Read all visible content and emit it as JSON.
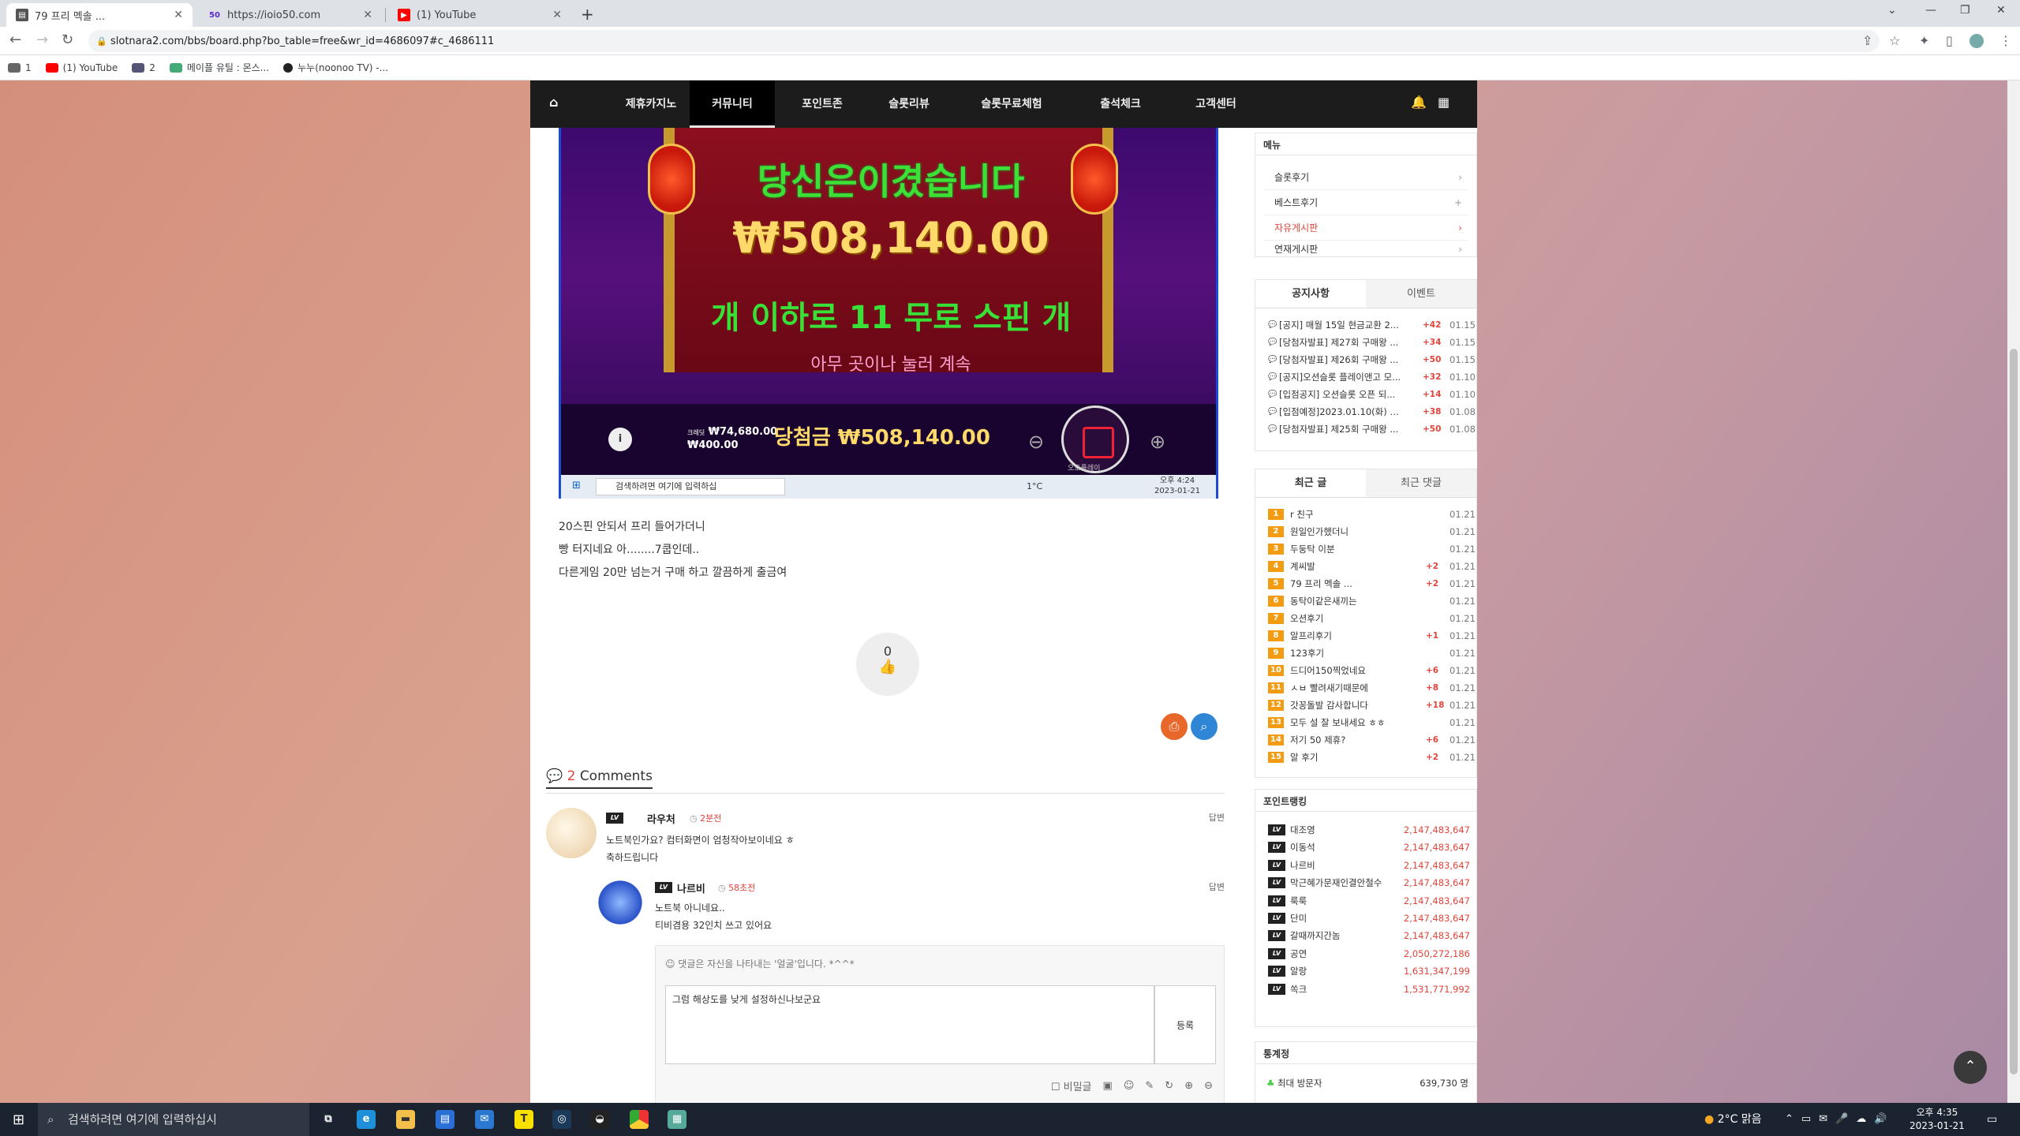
{
  "browser": {
    "tabs": [
      {
        "title": "79 프리 멕솔 ...",
        "active": true
      },
      {
        "title": "https://ioio50.com",
        "active": false
      },
      {
        "title": "(1) YouTube",
        "active": false
      }
    ],
    "url": "slotnara2.com/bbs/board.php?bo_table=free&wr_id=4686097#c_4686111",
    "bookmarks": [
      "1",
      "(1) YouTube",
      "2",
      "메이플 유틸 : 몬스...",
      "누누(noonoo TV) -..."
    ]
  },
  "site": {
    "nav": [
      "제휴카지노",
      "커뮤니티",
      "포인트존",
      "슬롯리뷰",
      "슬롯무료체험",
      "출석체크",
      "고객센터"
    ],
    "active_nav": "커뮤니티"
  },
  "screenshot": {
    "won_title": "당신은이겼습니다",
    "amount": "₩508,140.00",
    "freespin": "개 이하로 11 무로 스핀 개",
    "continue_text": "아무 곳이나 눌러 계속",
    "balance_label": "크레딧",
    "balance": "₩74,680.00",
    "bet": "₩400.00",
    "total_label": "당첨금 ₩508,140.00",
    "autoplay": "오토플레이",
    "taskbar_search": "검색하려면 여기에 입력하십",
    "temp": "1°C",
    "time": "오후 4:24",
    "date": "2023-01-21"
  },
  "post": {
    "lines": [
      "20스핀 안되서 프리 들어가더니",
      "빵 터지네요 아........7쿱인데..",
      "다른게임 20만 넘는거 구매 하고 깔끔하게 출금여"
    ],
    "likes": "0"
  },
  "comments": {
    "count": "2",
    "label": "Comments",
    "items": [
      {
        "name": "라우처",
        "time": "2분전",
        "reply": "답변",
        "text": [
          "노트북인가요? 컴터화면이 엄청작아보이네요 ㅎ",
          "축하드립니다"
        ]
      },
      {
        "name": "나르비",
        "time": "58초전",
        "reply": "답변",
        "text": [
          "노트북 아니네요..",
          "티비겸용 32인치 쓰고 있어요"
        ]
      }
    ],
    "form_hint": "댓글은 자신을 나타내는 '얼굴'입니다. *^^*",
    "form_text": "그럼 해상도를 낮게 설정하신나보군요",
    "submit": "등록",
    "secret": "비밀글"
  },
  "sidebar": {
    "menu_title": "메뉴",
    "menu": [
      "슬롯후기",
      "베스트후기",
      "자유게시판",
      "연재게시판"
    ],
    "notice_tabs": [
      "공지사항",
      "이벤트"
    ],
    "notices": [
      {
        "t": "[공지] 매월 15일 현금교환 2...",
        "c": "+42",
        "d": "01.15"
      },
      {
        "t": "[당첨자발표] 제27회 구매왕 ...",
        "c": "+34",
        "d": "01.15"
      },
      {
        "t": "[당첨자발표] 제26회 구매왕 ...",
        "c": "+50",
        "d": "01.15"
      },
      {
        "t": "[공지]오션슬롯 플레이앤고 모...",
        "c": "+32",
        "d": "01.10"
      },
      {
        "t": "[입점공지] 오션슬롯 오픈 되...",
        "c": "+14",
        "d": "01.10"
      },
      {
        "t": "[입점예정]2023.01.10(화) 낮 1...",
        "c": "+38",
        "d": "01.08"
      },
      {
        "t": "[당첨자발표] 제25회 구매왕 ...",
        "c": "+50",
        "d": "01.08"
      }
    ],
    "recent_tabs": [
      "최근 글",
      "최근 댓글"
    ],
    "recent": [
      {
        "t": "r 친구",
        "c": "",
        "d": "01.21"
      },
      {
        "t": "원일인가했더니",
        "c": "",
        "d": "01.21"
      },
      {
        "t": "두둥탁 이분",
        "c": "",
        "d": "01.21"
      },
      {
        "t": "계씨발",
        "c": "+2",
        "d": "01.21"
      },
      {
        "t": "79 프리 멕솔 ...",
        "c": "+2",
        "d": "01.21"
      },
      {
        "t": "동탁이같은새끼는",
        "c": "",
        "d": "01.21"
      },
      {
        "t": "오션후기",
        "c": "",
        "d": "01.21"
      },
      {
        "t": "알프리후기",
        "c": "+1",
        "d": "01.21"
      },
      {
        "t": "123후기",
        "c": "",
        "d": "01.21"
      },
      {
        "t": "드디어150찍었네요",
        "c": "+6",
        "d": "01.21"
      },
      {
        "t": "ㅅㅂ 빨려새기때문에",
        "c": "+8",
        "d": "01.21"
      },
      {
        "t": "갓꽁돌발 감사합니다",
        "c": "+18",
        "d": "01.21"
      },
      {
        "t": "모두 설 잘 보내세요 ㅎㅎ",
        "c": "",
        "d": "01.21"
      },
      {
        "t": "저기 50 제휴?",
        "c": "+6",
        "d": "01.21"
      },
      {
        "t": "알 후기",
        "c": "+2",
        "d": "01.21"
      }
    ],
    "rank_title": "포인트랭킹",
    "ranking": [
      {
        "n": "대조영",
        "v": "2,147,483,647"
      },
      {
        "n": "이동석",
        "v": "2,147,483,647"
      },
      {
        "n": "나르비",
        "v": "2,147,483,647"
      },
      {
        "n": "막근혜가문재인결안철수",
        "v": "2,147,483,647"
      },
      {
        "n": "룩룩",
        "v": "2,147,483,647"
      },
      {
        "n": "단미",
        "v": "2,147,483,647"
      },
      {
        "n": "갈때까지간놈",
        "v": "2,147,483,647"
      },
      {
        "n": "공연",
        "v": "2,050,272,186"
      },
      {
        "n": "알랑",
        "v": "1,631,347,199"
      },
      {
        "n": "쏙크",
        "v": "1,531,771,992"
      }
    ],
    "stats_title": "통계정",
    "stats_label": "최대 방문자",
    "stats_value": "639,730 명"
  },
  "taskbar": {
    "search": "검색하려면 여기에 입력하십시",
    "weather": "2°C 맑음",
    "time": "오후 4:35",
    "date": "2023-01-21"
  }
}
